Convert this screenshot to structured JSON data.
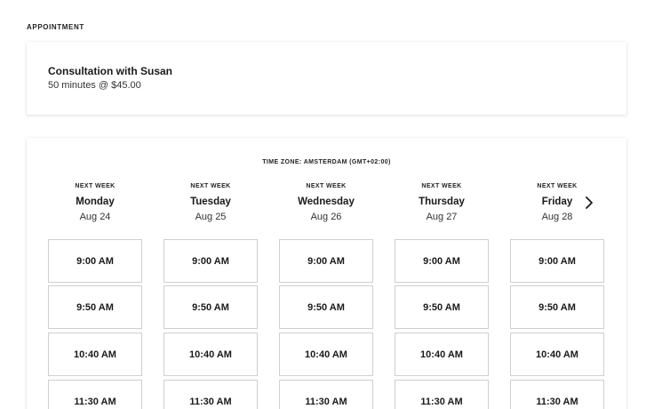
{
  "section_label": "APPOINTMENT",
  "appointment": {
    "title": "Consultation with Susan",
    "details": "50 minutes @ $45.00"
  },
  "schedule": {
    "timezone": "TIME ZONE: AMSTERDAM (GMT+02:00)",
    "next_icon": "chevron-right-icon",
    "days": [
      {
        "week": "NEXT WEEK",
        "name": "Monday",
        "date": "Aug 24",
        "slots": [
          "9:00 AM",
          "9:50 AM",
          "10:40 AM",
          "11:30 AM"
        ]
      },
      {
        "week": "NEXT WEEK",
        "name": "Tuesday",
        "date": "Aug 25",
        "slots": [
          "9:00 AM",
          "9:50 AM",
          "10:40 AM",
          "11:30 AM"
        ]
      },
      {
        "week": "NEXT WEEK",
        "name": "Wednesday",
        "date": "Aug 26",
        "slots": [
          "9:00 AM",
          "9:50 AM",
          "10:40 AM",
          "11:30 AM"
        ]
      },
      {
        "week": "NEXT WEEK",
        "name": "Thursday",
        "date": "Aug 27",
        "slots": [
          "9:00 AM",
          "9:50 AM",
          "10:40 AM",
          "11:30 AM"
        ]
      },
      {
        "week": "NEXT WEEK",
        "name": "Friday",
        "date": "Aug 28",
        "slots": [
          "9:00 AM",
          "9:50 AM",
          "10:40 AM",
          "11:30 AM"
        ]
      }
    ]
  }
}
